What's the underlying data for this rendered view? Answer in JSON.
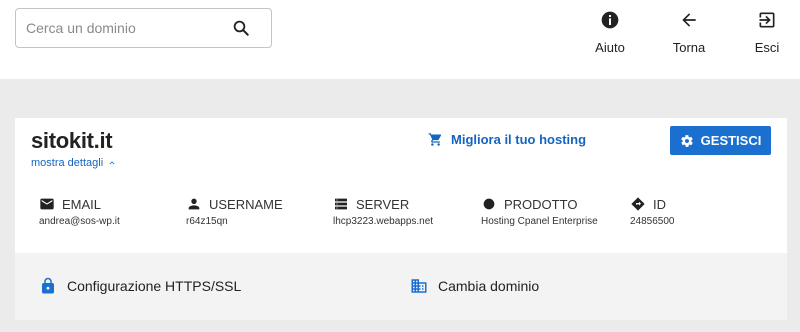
{
  "search": {
    "placeholder": "Cerca un dominio",
    "icon": "search-icon"
  },
  "nav": [
    {
      "label": "Aiuto",
      "icon": "info-icon"
    },
    {
      "label": "Torna",
      "icon": "arrow-left-icon"
    },
    {
      "label": "Esci",
      "icon": "exit-icon"
    }
  ],
  "site": {
    "title": "sitokit.it",
    "details_label": "mostra dettagli",
    "upgrade_label": "Migliora il tuo hosting",
    "manage_label": "GESTISCI"
  },
  "info": [
    {
      "label": "EMAIL",
      "value": "andrea@sos-wp.it",
      "icon": "mail-icon"
    },
    {
      "label": "USERNAME",
      "value": "r64z15qn",
      "icon": "person-icon"
    },
    {
      "label": "SERVER",
      "value": "lhcp3223.webapps.net",
      "icon": "server-icon"
    },
    {
      "label": "PRODOTTO",
      "value": "Hosting Cpanel Enterprise",
      "icon": "circle-icon"
    },
    {
      "label": "ID",
      "value": "24856500",
      "icon": "diamond-icon"
    }
  ],
  "actions": [
    {
      "label": "Configurazione HTTPS/SSL",
      "icon": "lock-icon"
    },
    {
      "label": "Cambia dominio",
      "icon": "building-icon"
    }
  ],
  "colors": {
    "accent": "#1a6fcf",
    "link": "#1565c0",
    "background": "#ebebeb"
  }
}
